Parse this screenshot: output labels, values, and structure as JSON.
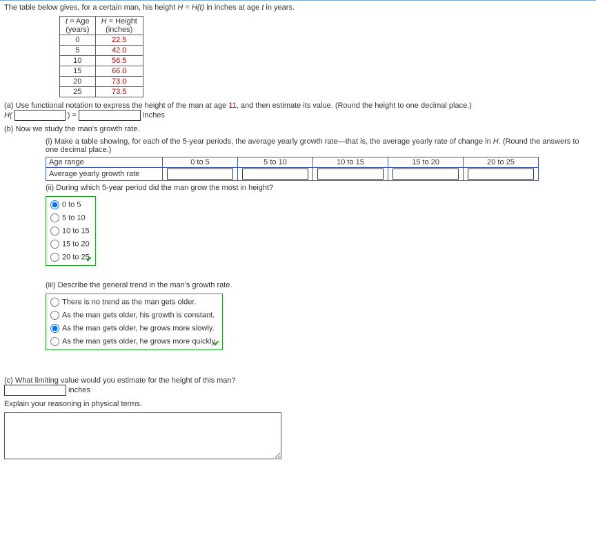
{
  "intro": "The table below gives, for a certain man, his height ",
  "intro2": " in inches at age ",
  "intro3": " in years.",
  "H": "H",
  "Ht": "H(t)",
  "eq": " = ",
  "t": "t",
  "tbl": {
    "h1a": "t",
    "h1b": " = Age",
    "h1c": "(years)",
    "h2a": "H",
    "h2b": " = Height",
    "h2c": "(inches)",
    "rows": [
      {
        "t": "0",
        "h": "22.5"
      },
      {
        "t": "5",
        "h": "42.0"
      },
      {
        "t": "10",
        "h": "56.5"
      },
      {
        "t": "15",
        "h": "66.0"
      },
      {
        "t": "20",
        "h": "73.0"
      },
      {
        "t": "25",
        "h": "73.5"
      }
    ]
  },
  "a": {
    "text1": "(a) Use functional notation to express the height of the man at age ",
    "age": "11",
    "text2": ", and then estimate its value. (Round the height to one decimal place.)",
    "Hopen": "H(",
    "close": ") =",
    "unit": "inches"
  },
  "b": {
    "text": "(b) Now we study the man's growth rate.",
    "i": {
      "text": "(i) Make a table showing, for each of the 5-year periods, the average yearly growth rate—that is, the average yearly rate of change in ",
      "H": "H",
      "text2": ". (Round the answers to one decimal place.)",
      "row1": "Age range",
      "row2": "Average yearly growth rate",
      "cols": [
        "0 to 5",
        "5 to 10",
        "10 to 15",
        "15 to 20",
        "20 to 25"
      ]
    },
    "ii": {
      "q": "(ii) During which 5-year period did the man grow the most in height?",
      "opts": [
        "0 to 5",
        "5 to 10",
        "10 to 15",
        "15 to 20",
        "20 to 25"
      ]
    },
    "iii": {
      "q": "(iii) Describe the general trend in the man's growth rate.",
      "opts": [
        "There is no trend as the man gets older.",
        "As the man gets older, his growth is constant.",
        "As the man gets older, he grows more slowly.",
        "As the man gets older, he grows more quickly."
      ]
    }
  },
  "c": {
    "q": "(c) What limiting value would you estimate for the height of this man?",
    "unit": "inches",
    "explain": "Explain your reasoning in physical terms."
  },
  "checkmark": "✔"
}
